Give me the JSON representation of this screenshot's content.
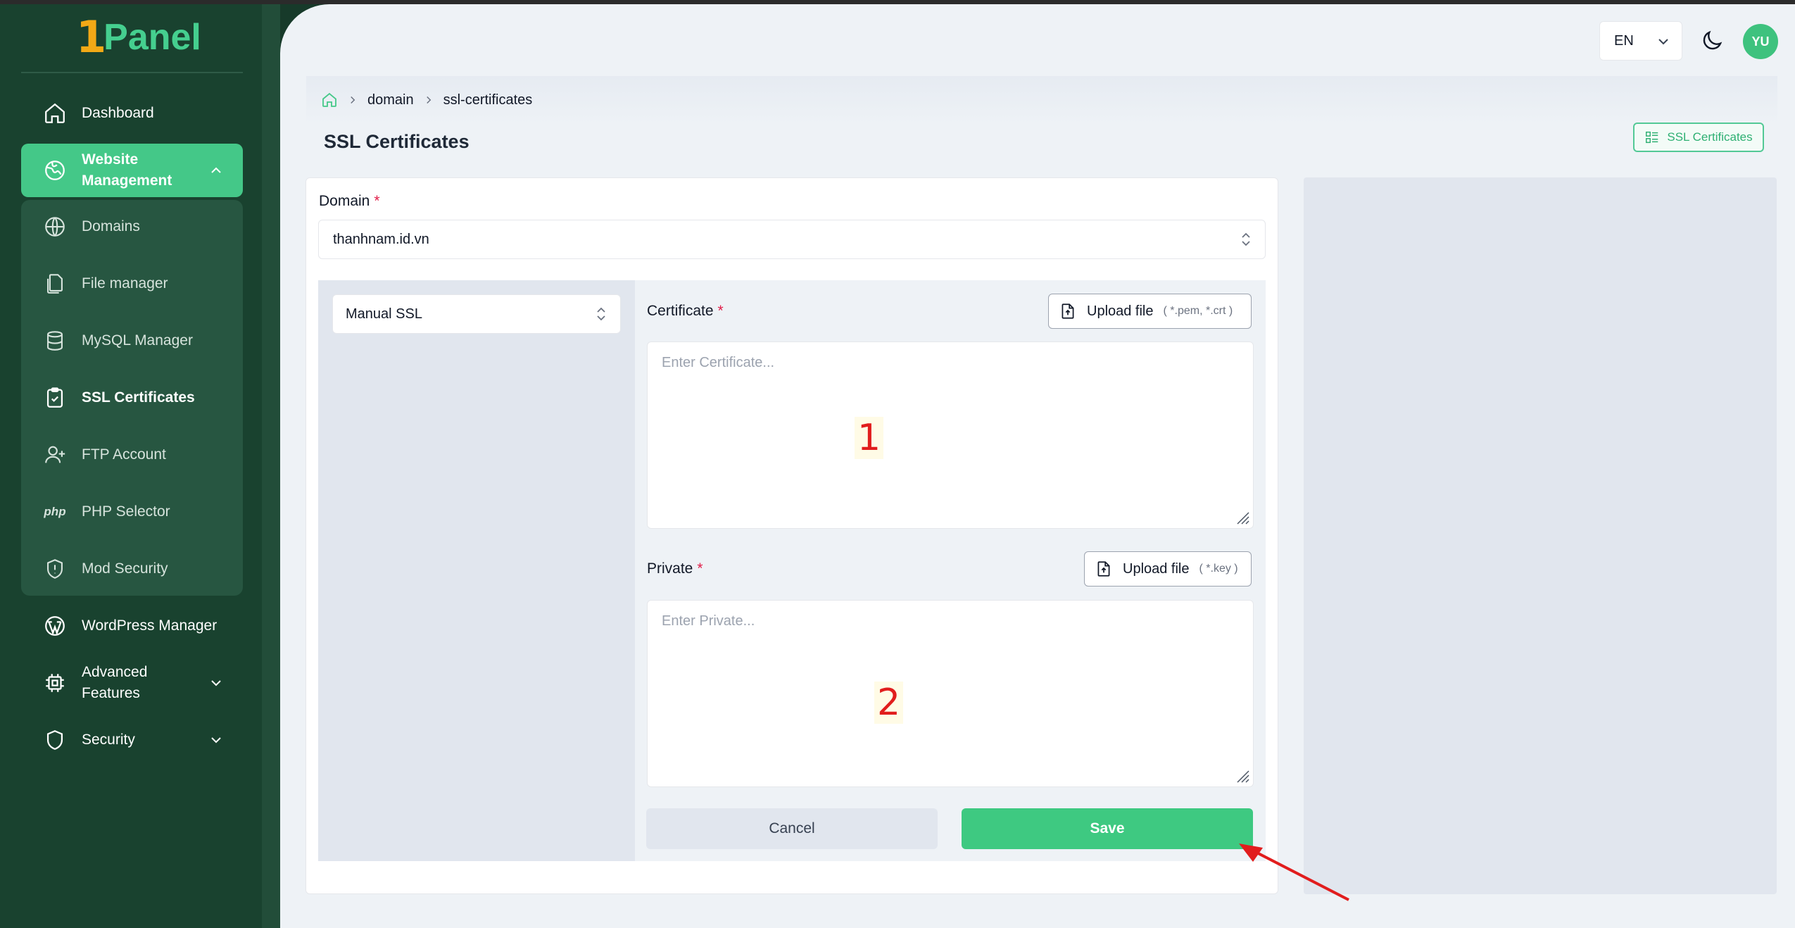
{
  "brand": {
    "logo_number": "1",
    "logo_text": "Panel"
  },
  "sidebar": {
    "items": [
      {
        "label": "Dashboard",
        "icon": "home-icon"
      },
      {
        "label": "Website\nManagement",
        "icon": "globe-icon"
      },
      {
        "label": "Domains",
        "icon": "globe-outline-icon"
      },
      {
        "label": "File manager",
        "icon": "files-icon"
      },
      {
        "label": "MySQL Manager",
        "icon": "database-icon"
      },
      {
        "label": "SSL Certificates",
        "icon": "clipboard-check-icon"
      },
      {
        "label": "FTP Account",
        "icon": "user-plus-icon"
      },
      {
        "label": "PHP Selector",
        "icon": "php-icon",
        "icon_text": "php"
      },
      {
        "label": "Mod Security",
        "icon": "shield-alert-icon"
      },
      {
        "label": "WordPress Manager",
        "icon": "wordpress-icon"
      },
      {
        "label": "Advanced\nFeatures",
        "icon": "cpu-icon"
      },
      {
        "label": "Security",
        "icon": "shield-icon"
      }
    ]
  },
  "header": {
    "language": "EN",
    "avatar_initials": "YU"
  },
  "breadcrumb": {
    "items": [
      "domain",
      "ssl-certificates"
    ]
  },
  "page": {
    "title": "SSL Certificates",
    "ssl_button_label": "SSL Certificates"
  },
  "form": {
    "domain_label": "Domain",
    "required_mark": "*",
    "domain_value": "thanhnam.id.vn",
    "ssl_type_value": "Manual SSL",
    "certificate_label": "Certificate",
    "certificate_placeholder": "Enter Certificate...",
    "certificate_upload_label": "Upload file",
    "certificate_upload_hint": "( *.pem, *.crt )",
    "private_label": "Private",
    "private_placeholder": "Enter Private...",
    "private_upload_label": "Upload file",
    "private_upload_hint": "( *.key )",
    "cancel_label": "Cancel",
    "save_label": "Save"
  },
  "annotations": {
    "marker_1": "1",
    "marker_2": "2"
  },
  "colors": {
    "sidebar_bg": "#19422f",
    "accent": "#44c888",
    "save_button": "#3ec981",
    "required": "#e11d48",
    "annotation_arrow": "#e11d1d"
  }
}
